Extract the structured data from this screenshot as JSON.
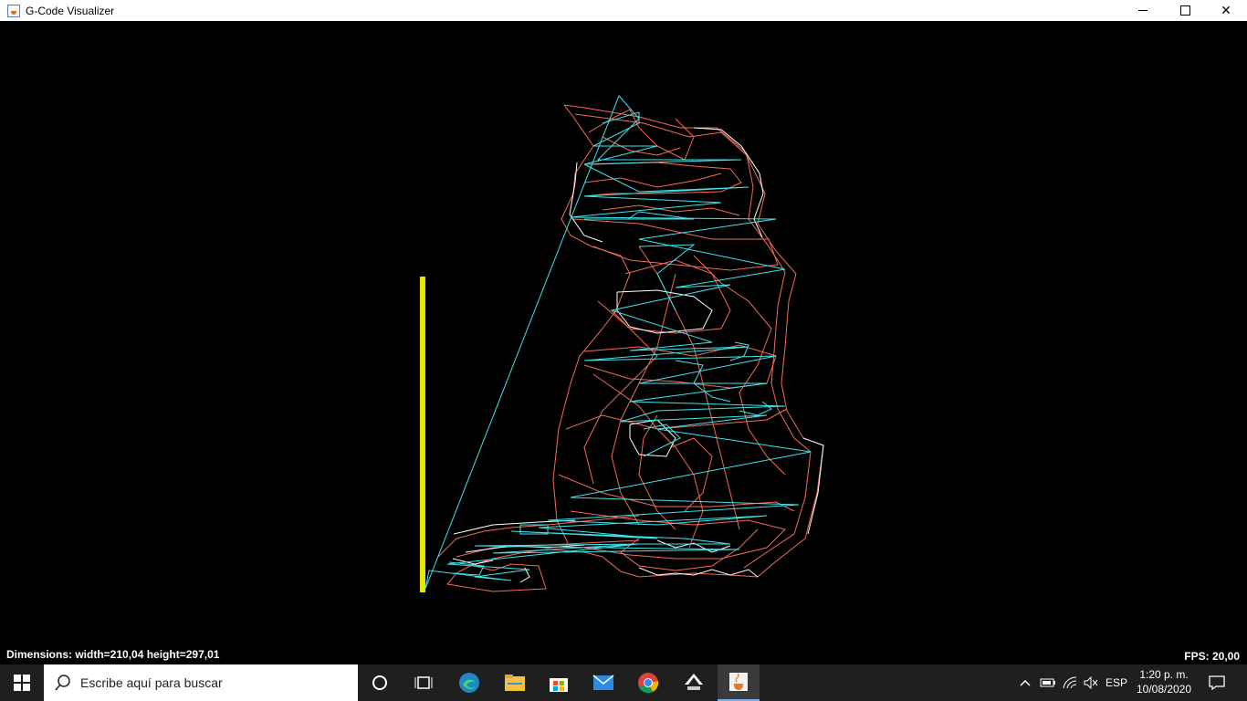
{
  "window": {
    "title": "G-Code Visualizer"
  },
  "status": {
    "dimensions": "Dimensions: width=210,04 height=297,01",
    "fps": "FPS: 20,00"
  },
  "taskbar": {
    "search_placeholder": "Escribe aquí para buscar",
    "language": "ESP",
    "time": "1:20 p. m.",
    "date": "10/08/2020"
  },
  "colors": {
    "background": "#000000",
    "outline": "#f26b5a",
    "travel": "#3fe3ea",
    "paper_edge": "#e6e600",
    "window": "#ffffff"
  },
  "icons": [
    "java-app-icon",
    "minimize-icon",
    "maximize-icon",
    "close-icon",
    "windows-start-icon",
    "search-icon",
    "cortana-icon",
    "task-view-icon",
    "edge-icon",
    "file-explorer-icon",
    "store-icon",
    "mail-icon",
    "chrome-icon",
    "inkscape-icon",
    "java-taskbar-icon",
    "chevron-up-icon",
    "battery-icon",
    "wifi-icon",
    "speaker-muted-icon",
    "notification-icon"
  ]
}
